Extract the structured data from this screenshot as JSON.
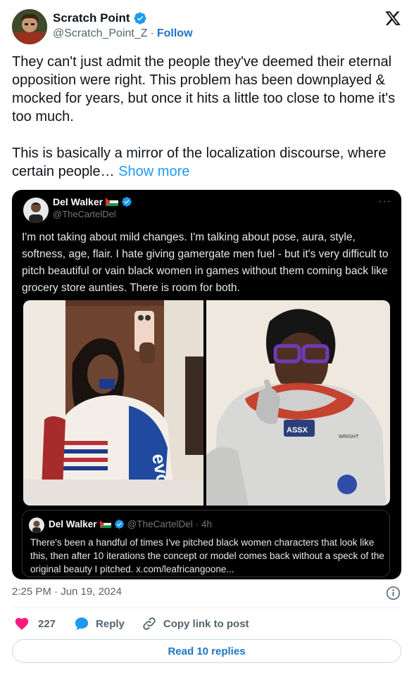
{
  "author": {
    "name": "Scratch Point",
    "handle": "@Scratch_Point_Z",
    "separator": "·",
    "follow_label": "Follow"
  },
  "tweet": {
    "text": "They can't just admit the people they've deemed their eternal opposition were right. This problem has been downplayed & mocked for years, but once it hits a little too close to home it's too much.\n\nThis is basically a mirror of the localization discourse, where certain people… ",
    "show_more": "Show more"
  },
  "quote": {
    "name": "Del Walker",
    "handle": "@TheCartelDel",
    "more": "···",
    "text": "I'm not taking about mild changes. I'm talking about pose, aura, style, softness, age, flair. I hate giving gamergate men fuel - but it's very difficult to pitch beautiful or vain black women in games without them coming back like grocery store aunties. There is room for both.",
    "nested": {
      "name": "Del Walker",
      "handle": "@TheCartelDel",
      "time": "· 4h",
      "text": "There's been a handful of times I've pitched black women characters that look like this, then after 10 iterations the concept or model comes back without a speck of the original beauty I pitched. x.com/leafricangoone..."
    }
  },
  "meta": {
    "timestamp": "2:25 PM · Jun 19, 2024"
  },
  "actions": {
    "like_count": "227",
    "reply_label": "Reply",
    "copy_label": "Copy link to post"
  },
  "read_replies": "Read 10 replies",
  "colors": {
    "accent": "#1d9bf0",
    "link_dark": "#1d74c4",
    "like": "#f91880",
    "text": "#0f1419",
    "muted": "#536471"
  }
}
